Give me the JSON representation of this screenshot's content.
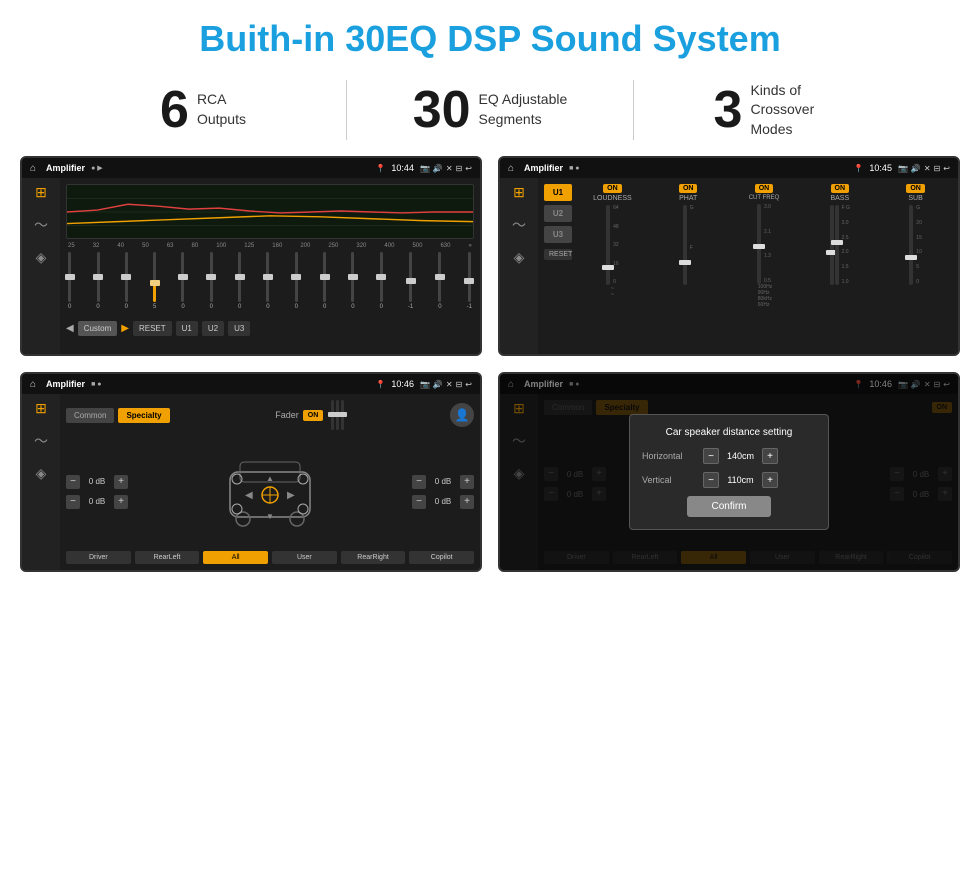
{
  "page": {
    "title": "Buith-in 30EQ DSP Sound System",
    "title_color": "#1a9fdf"
  },
  "stats": [
    {
      "number": "6",
      "label": "RCA\nOutputs"
    },
    {
      "number": "30",
      "label": "EQ Adjustable\nSegments"
    },
    {
      "number": "3",
      "label": "Kinds of\nCrossover Modes"
    }
  ],
  "screens": {
    "eq": {
      "status_bar": {
        "app": "Amplifier",
        "time": "10:44"
      },
      "freq_labels": [
        "25",
        "32",
        "40",
        "50",
        "63",
        "80",
        "100",
        "125",
        "160",
        "200",
        "250",
        "320",
        "400",
        "500",
        "630"
      ],
      "slider_values": [
        "0",
        "0",
        "0",
        "5",
        "0",
        "0",
        "0",
        "0",
        "0",
        "0",
        "0",
        "0",
        "-1",
        "0",
        "-1"
      ],
      "buttons": [
        "Custom",
        "RESET",
        "U1",
        "U2",
        "U3"
      ]
    },
    "crossover": {
      "status_bar": {
        "app": "Amplifier",
        "time": "10:45"
      },
      "u_buttons": [
        "U1",
        "U2",
        "U3"
      ],
      "channels": [
        "LOUDNESS",
        "PHAT",
        "CUT FREQ",
        "BASS",
        "SUB"
      ],
      "toggles": [
        "ON",
        "ON",
        "ON",
        "ON",
        "ON"
      ]
    },
    "fader": {
      "status_bar": {
        "app": "Amplifier",
        "time": "10:46"
      },
      "tabs": [
        "Common",
        "Specialty"
      ],
      "fader_label": "Fader",
      "toggle": "ON",
      "dB_values": [
        "0 dB",
        "0 dB",
        "0 dB",
        "0 dB"
      ],
      "bottom_buttons": [
        "Driver",
        "RearLeft",
        "All",
        "User",
        "RearRight",
        "Copilot"
      ]
    },
    "dialog": {
      "status_bar": {
        "app": "Amplifier",
        "time": "10:46"
      },
      "tabs": [
        "Common",
        "Specialty"
      ],
      "title": "Car speaker distance setting",
      "horizontal_label": "Horizontal",
      "horizontal_value": "140cm",
      "vertical_label": "Vertical",
      "vertical_value": "110cm",
      "confirm_label": "Confirm",
      "dB_values": [
        "0 dB",
        "0 dB"
      ]
    }
  }
}
